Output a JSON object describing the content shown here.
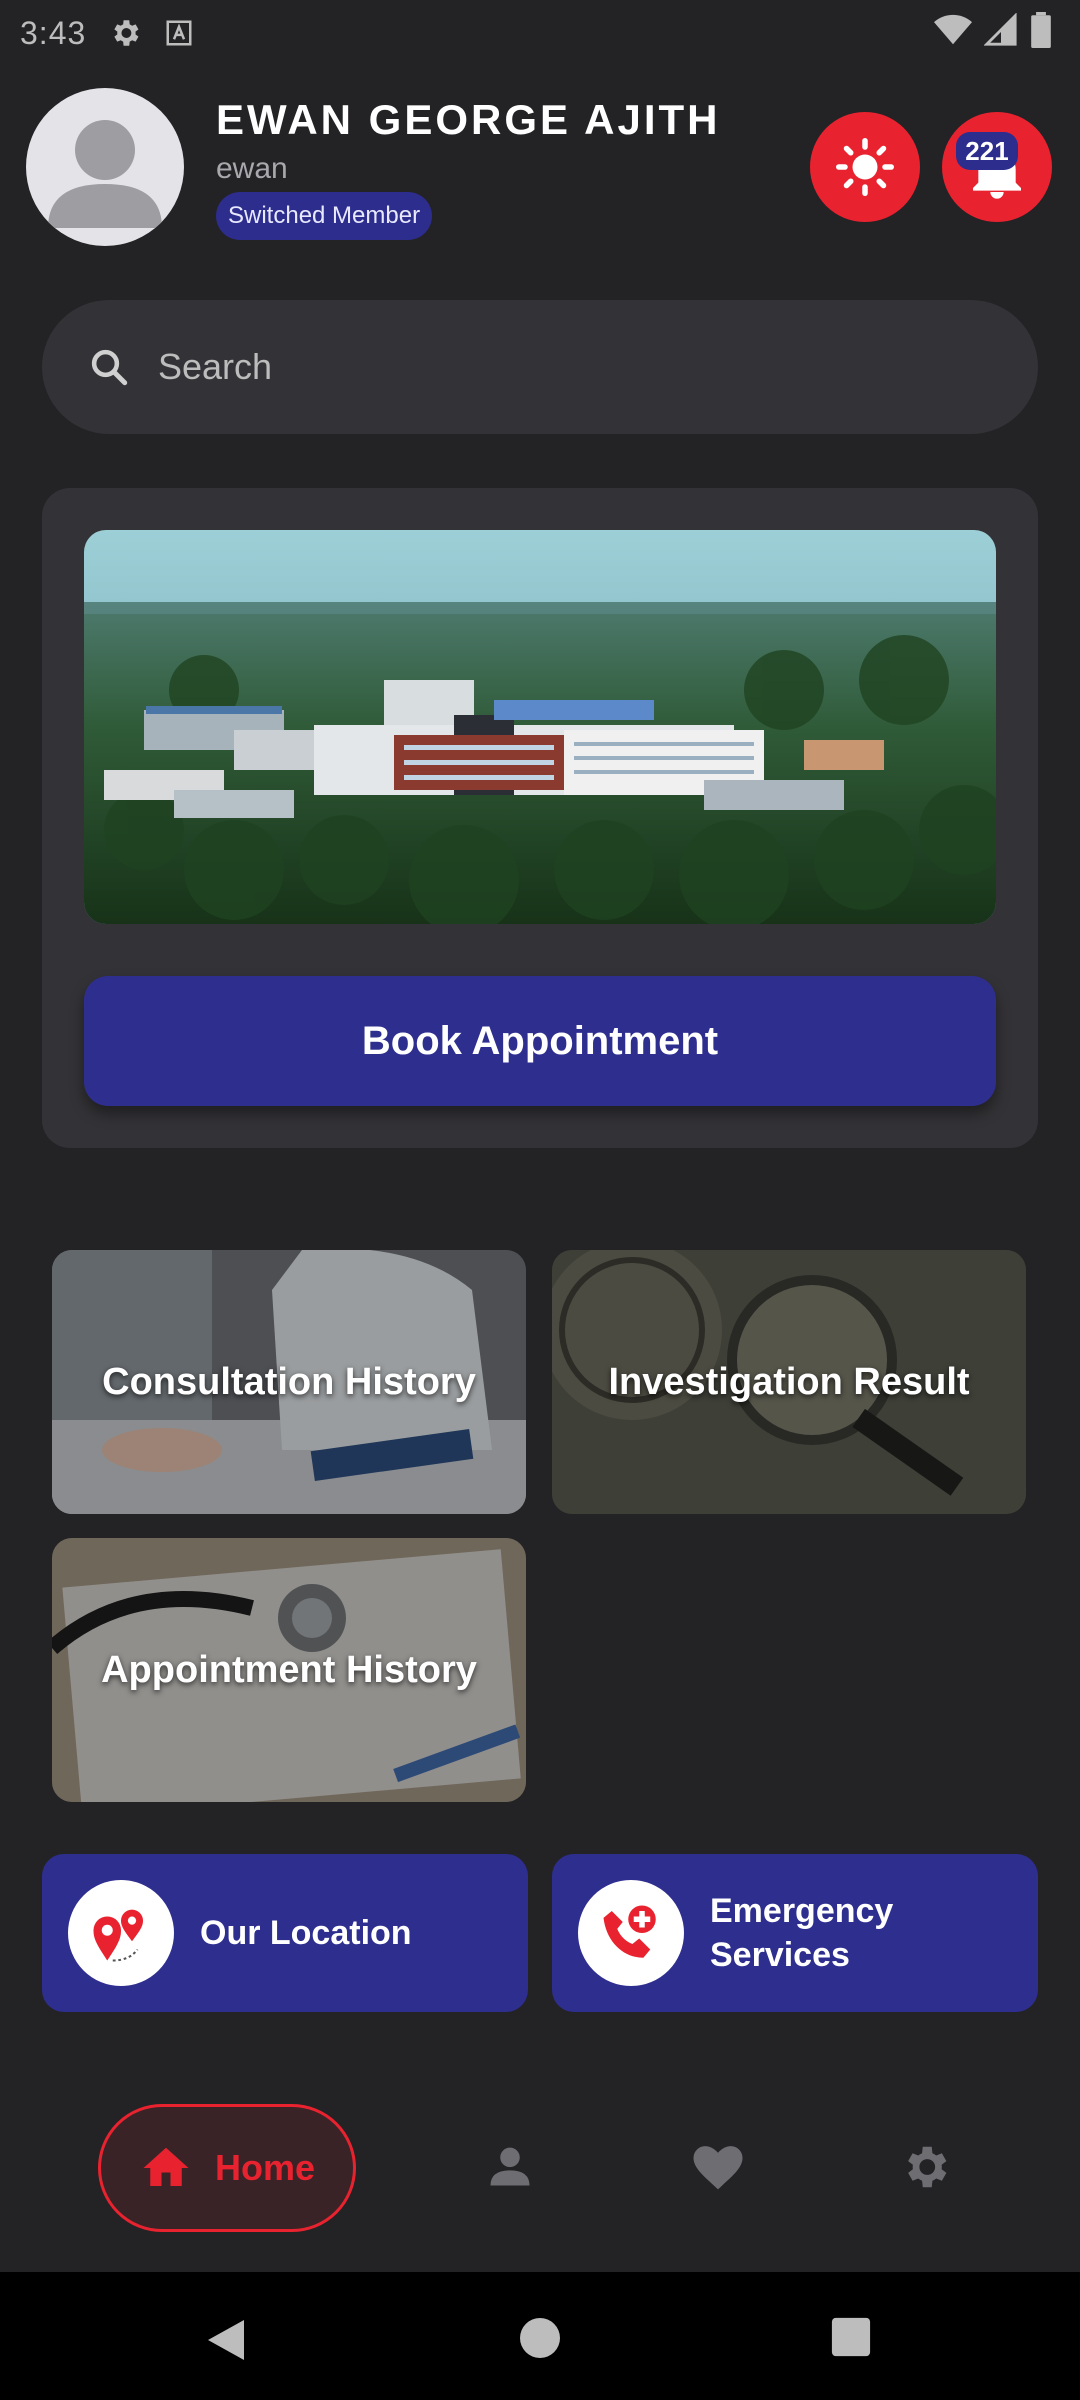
{
  "status_bar": {
    "time": "3:43",
    "icons": [
      "gear-icon",
      "font-icon",
      "wifi-icon",
      "signal-icon",
      "battery-icon"
    ]
  },
  "user": {
    "name": "EWAN  GEORGE  AJITH",
    "handle": "ewan",
    "badge": "Switched Member"
  },
  "notifications": {
    "count": "221"
  },
  "search": {
    "placeholder": "Search"
  },
  "hero": {
    "book_label": "Book Appointment"
  },
  "tiles": [
    {
      "label": "Consultation History"
    },
    {
      "label": "Investigation Result"
    },
    {
      "label": "Appointment History"
    }
  ],
  "actions": {
    "location_label": "Our Location",
    "emergency_label": "Emergency Services"
  },
  "bottom_nav": {
    "home_label": "Home",
    "items": [
      "home-icon",
      "person-icon",
      "heart-icon",
      "settings-icon"
    ]
  },
  "colors": {
    "background": "#232225",
    "card": "#333236",
    "primary": "#2e2e8f",
    "accent": "#e8232f"
  }
}
